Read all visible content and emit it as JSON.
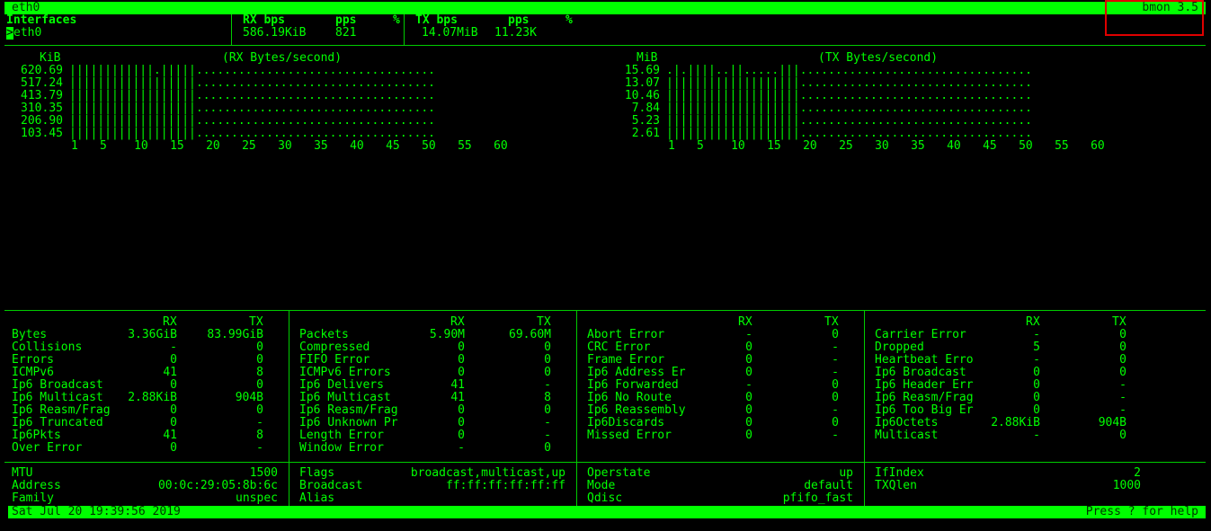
{
  "header": {
    "interface_tab": "eth0",
    "app_name": "bmon 3.5"
  },
  "iftable": {
    "col_interfaces": "Interfaces",
    "col_rx_bps": "RX bps",
    "col_pps": "pps",
    "col_pct": "%",
    "col_tx_bps": "TX bps",
    "col_tx_pps": "pps",
    "col_tx_pct": "%",
    "row": {
      "cursor": ">",
      "name": "eth0",
      "rx_bps": "586.19KiB",
      "rx_pps": "821",
      "tx_bps": "14.07MiB",
      "tx_pps": "11.23K"
    }
  },
  "graphs": [
    {
      "unit": "KiB",
      "title": "(RX Bytes/second)",
      "yticks": [
        "620.69",
        "517.24",
        "413.79",
        "310.35",
        "206.90",
        "103.45"
      ],
      "xticks": [
        "1",
        "5",
        "10",
        "15",
        "20",
        "25",
        "30",
        "35",
        "40",
        "45",
        "50",
        "55",
        "60"
      ],
      "rows": [
        "||||||||||||.|||||..................................",
        "||||||||||||||||||..................................",
        "||||||||||||||||||..................................",
        "||||||||||||||||||..................................",
        "||||||||||||||||||..................................",
        "||||||||||||||||||.................................."
      ]
    },
    {
      "unit": "MiB",
      "title": "(TX Bytes/second)",
      "yticks": [
        "15.69",
        "13.07",
        "10.46",
        "7.84",
        "5.23",
        "2.61"
      ],
      "xticks": [
        "1",
        "5",
        "10",
        "15",
        "20",
        "25",
        "30",
        "35",
        "40",
        "45",
        "50",
        "55",
        "60"
      ],
      "rows": [
        ".|.||||..||.....|||.................................",
        "|||||||||||||||||||.................................",
        "|||||||||||||||||||.................................",
        "|||||||||||||||||||.................................",
        "|||||||||||||||||||.................................",
        "|||||||||||||||||||................................."
      ]
    }
  ],
  "stats": [
    {
      "rx": "RX",
      "tx": "TX",
      "rows": [
        {
          "label": "Bytes",
          "rx": "3.36GiB",
          "tx": "83.99GiB"
        },
        {
          "label": "Collisions",
          "rx": "-",
          "tx": "0"
        },
        {
          "label": "Errors",
          "rx": "0",
          "tx": "0"
        },
        {
          "label": "ICMPv6",
          "rx": "41",
          "tx": "8"
        },
        {
          "label": "Ip6 Broadcast",
          "rx": "0",
          "tx": "0"
        },
        {
          "label": "Ip6 Multicast",
          "rx": "2.88KiB",
          "tx": "904B"
        },
        {
          "label": "Ip6 Reasm/Frag",
          "rx": "0",
          "tx": "0"
        },
        {
          "label": "Ip6 Truncated",
          "rx": "0",
          "tx": "-"
        },
        {
          "label": "Ip6Pkts",
          "rx": "41",
          "tx": "8"
        },
        {
          "label": "Over Error",
          "rx": "0",
          "tx": "-"
        }
      ]
    },
    {
      "rx": "RX",
      "tx": "TX",
      "rows": [
        {
          "label": "Packets",
          "rx": "5.90M",
          "tx": "69.60M"
        },
        {
          "label": "Compressed",
          "rx": "0",
          "tx": "0"
        },
        {
          "label": "FIFO Error",
          "rx": "0",
          "tx": "0"
        },
        {
          "label": "ICMPv6 Errors",
          "rx": "0",
          "tx": "0"
        },
        {
          "label": "Ip6 Delivers",
          "rx": "41",
          "tx": "-"
        },
        {
          "label": "Ip6 Multicast",
          "rx": "41",
          "tx": "8"
        },
        {
          "label": "Ip6 Reasm/Frag",
          "rx": "0",
          "tx": "0"
        },
        {
          "label": "Ip6 Unknown Pr",
          "rx": "0",
          "tx": "-"
        },
        {
          "label": "Length Error",
          "rx": "0",
          "tx": "-"
        },
        {
          "label": "Window Error",
          "rx": "-",
          "tx": "0"
        }
      ]
    },
    {
      "rx": "RX",
      "tx": "TX",
      "rows": [
        {
          "label": "Abort Error",
          "rx": "-",
          "tx": "0"
        },
        {
          "label": "CRC Error",
          "rx": "0",
          "tx": "-"
        },
        {
          "label": "Frame Error",
          "rx": "0",
          "tx": "-"
        },
        {
          "label": "Ip6 Address Er",
          "rx": "0",
          "tx": "-"
        },
        {
          "label": "Ip6 Forwarded",
          "rx": "-",
          "tx": "0"
        },
        {
          "label": "Ip6 No Route",
          "rx": "0",
          "tx": "0"
        },
        {
          "label": "Ip6 Reassembly",
          "rx": "0",
          "tx": "-"
        },
        {
          "label": "Ip6Discards",
          "rx": "0",
          "tx": "0"
        },
        {
          "label": "Missed Error",
          "rx": "0",
          "tx": "-"
        }
      ]
    },
    {
      "rx": "RX",
      "tx": "TX",
      "rows": [
        {
          "label": "Carrier Error",
          "rx": "-",
          "tx": "0"
        },
        {
          "label": "Dropped",
          "rx": "5",
          "tx": "0"
        },
        {
          "label": "Heartbeat Erro",
          "rx": "-",
          "tx": "0"
        },
        {
          "label": "Ip6 Broadcast",
          "rx": "0",
          "tx": "0"
        },
        {
          "label": "Ip6 Header Err",
          "rx": "0",
          "tx": "-"
        },
        {
          "label": "Ip6 Reasm/Frag",
          "rx": "0",
          "tx": "-"
        },
        {
          "label": "Ip6 Too Big Er",
          "rx": "0",
          "tx": "-"
        },
        {
          "label": "Ip6Octets",
          "rx": "2.88KiB",
          "tx": "904B"
        },
        {
          "label": "Multicast",
          "rx": "-",
          "tx": "0"
        }
      ]
    }
  ],
  "info": [
    [
      {
        "label": "MTU",
        "value": "1500"
      },
      {
        "label": "Address",
        "value": "00:0c:29:05:8b:6c"
      },
      {
        "label": "Family",
        "value": "unspec"
      }
    ],
    [
      {
        "label": "Flags",
        "value": "broadcast,multicast,up"
      },
      {
        "label": "Broadcast",
        "value": "ff:ff:ff:ff:ff:ff"
      },
      {
        "label": "Alias",
        "value": ""
      }
    ],
    [
      {
        "label": "Operstate",
        "value": "up"
      },
      {
        "label": "Mode",
        "value": "default"
      },
      {
        "label": "Qdisc",
        "value": "pfifo_fast"
      }
    ],
    [
      {
        "label": "IfIndex",
        "value": "2"
      },
      {
        "label": "TXQlen",
        "value": "1000"
      }
    ]
  ],
  "footer": {
    "datetime": "Sat Jul 20 19:39:56 2019",
    "help": "Press ? for help"
  }
}
